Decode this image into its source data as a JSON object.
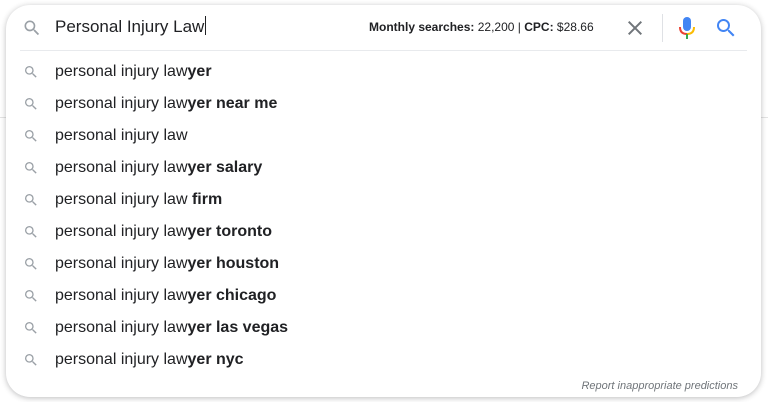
{
  "search": {
    "query": "Personal Injury Law",
    "metrics": {
      "monthly_label": "Monthly searches:",
      "monthly_value": "22,200",
      "separator": "|",
      "cpc_label": "CPC:",
      "cpc_value": "$28.66"
    }
  },
  "suggestions": [
    {
      "prefix": "personal injury law",
      "suffix": "yer"
    },
    {
      "prefix": "personal injury law",
      "suffix": "yer near me"
    },
    {
      "prefix": "personal injury law",
      "suffix": ""
    },
    {
      "prefix": "personal injury law",
      "suffix": "yer salary"
    },
    {
      "prefix": "personal injury law ",
      "suffix": "firm"
    },
    {
      "prefix": "personal injury law",
      "suffix": "yer toronto"
    },
    {
      "prefix": "personal injury law",
      "suffix": "yer houston"
    },
    {
      "prefix": "personal injury law",
      "suffix": "yer chicago"
    },
    {
      "prefix": "personal injury law",
      "suffix": "yer las vegas"
    },
    {
      "prefix": "personal injury law",
      "suffix": "yer nyc"
    }
  ],
  "footer": {
    "report_link": "Report inappropriate predictions"
  },
  "icons": {
    "search": "search-icon",
    "clear": "close-icon",
    "mic": "microphone-icon",
    "suggestion": "search-icon"
  },
  "colors": {
    "icon_gray": "#9aa0a6",
    "clear_gray": "#70757a",
    "google_blue": "#4285f4",
    "google_red": "#ea4335",
    "google_yellow": "#fbbc04",
    "google_green": "#34a853",
    "text": "#202124"
  }
}
